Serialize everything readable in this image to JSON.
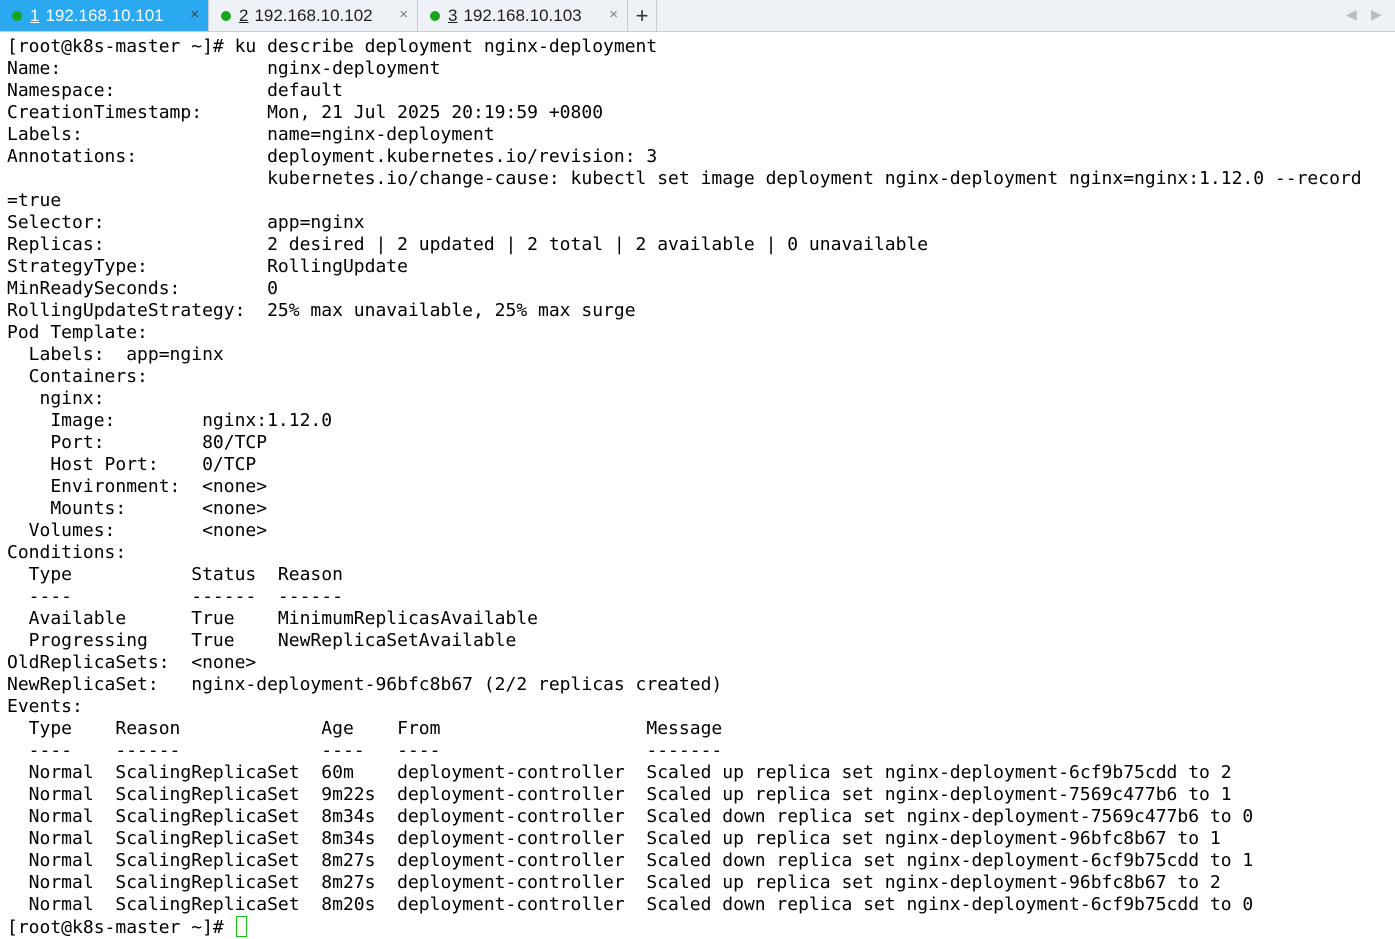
{
  "tabs": [
    {
      "num": "1",
      "host": "192.168.10.101",
      "active": true,
      "close": "×"
    },
    {
      "num": "2",
      "host": "192.168.10.102",
      "active": false,
      "close": "×"
    },
    {
      "num": "3",
      "host": "192.168.10.103",
      "active": false,
      "close": "×"
    }
  ],
  "tabbar": {
    "new_tab": "+",
    "prev": "◀",
    "next": "▶"
  },
  "colors": {
    "active_tab": "#2aa8f0",
    "status_dot": "#16a51c",
    "cursor": "#14c414"
  },
  "terminal": {
    "lines": [
      "[root@k8s-master ~]# ku describe deployment nginx-deployment",
      "Name:                   nginx-deployment",
      "Namespace:              default",
      "CreationTimestamp:      Mon, 21 Jul 2025 20:19:59 +0800",
      "Labels:                 name=nginx-deployment",
      "Annotations:            deployment.kubernetes.io/revision: 3",
      "                        kubernetes.io/change-cause: kubectl set image deployment nginx-deployment nginx=nginx:1.12.0 --record",
      "=true",
      "Selector:               app=nginx",
      "Replicas:               2 desired | 2 updated | 2 total | 2 available | 0 unavailable",
      "StrategyType:           RollingUpdate",
      "MinReadySeconds:        0",
      "RollingUpdateStrategy:  25% max unavailable, 25% max surge",
      "Pod Template:",
      "  Labels:  app=nginx",
      "  Containers:",
      "   nginx:",
      "    Image:        nginx:1.12.0",
      "    Port:         80/TCP",
      "    Host Port:    0/TCP",
      "    Environment:  <none>",
      "    Mounts:       <none>",
      "  Volumes:        <none>",
      "Conditions:",
      "  Type           Status  Reason",
      "  ----           ------  ------",
      "  Available      True    MinimumReplicasAvailable",
      "  Progressing    True    NewReplicaSetAvailable",
      "OldReplicaSets:  <none>",
      "NewReplicaSet:   nginx-deployment-96bfc8b67 (2/2 replicas created)",
      "Events:",
      "  Type    Reason             Age    From                   Message",
      "  ----    ------             ----   ----                   -------",
      "  Normal  ScalingReplicaSet  60m    deployment-controller  Scaled up replica set nginx-deployment-6cf9b75cdd to 2",
      "  Normal  ScalingReplicaSet  9m22s  deployment-controller  Scaled up replica set nginx-deployment-7569c477b6 to 1",
      "  Normal  ScalingReplicaSet  8m34s  deployment-controller  Scaled down replica set nginx-deployment-7569c477b6 to 0",
      "  Normal  ScalingReplicaSet  8m34s  deployment-controller  Scaled up replica set nginx-deployment-96bfc8b67 to 1",
      "  Normal  ScalingReplicaSet  8m27s  deployment-controller  Scaled down replica set nginx-deployment-6cf9b75cdd to 1",
      "  Normal  ScalingReplicaSet  8m27s  deployment-controller  Scaled up replica set nginx-deployment-96bfc8b67 to 2",
      "  Normal  ScalingReplicaSet  8m20s  deployment-controller  Scaled down replica set nginx-deployment-6cf9b75cdd to 0"
    ],
    "prompt": "[root@k8s-master ~]# "
  }
}
